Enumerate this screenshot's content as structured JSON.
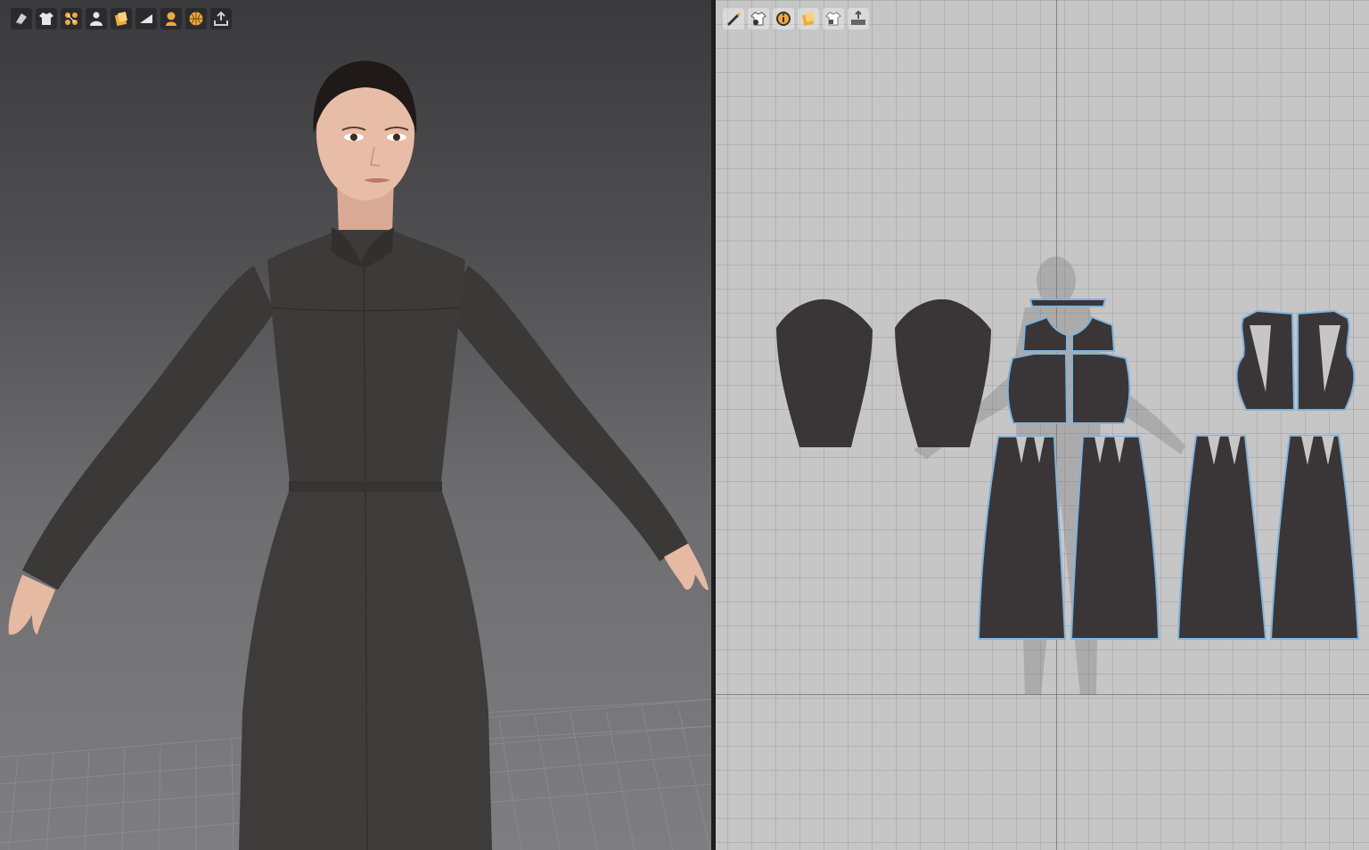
{
  "toolbar_3d": {
    "icons": [
      "fabric-icon",
      "garment-icon",
      "sewing-points-icon",
      "avatar-icon",
      "pattern-piece-icon",
      "plane-icon",
      "avatar-color-icon",
      "texture-sphere-icon",
      "export-icon"
    ]
  },
  "toolbar_2d": {
    "icons": [
      "edit-pen-icon",
      "show-garment-icon",
      "info-icon",
      "pattern-piece-icon",
      "garment-lock-icon",
      "ruler-export-icon"
    ]
  },
  "colors": {
    "garment": "#3a3836",
    "pattern_fill": "#3a3637",
    "pattern_seam": "#7fb3dc",
    "accent_orange": "#f2a93b",
    "grid_2d": "#c6c6c6"
  }
}
